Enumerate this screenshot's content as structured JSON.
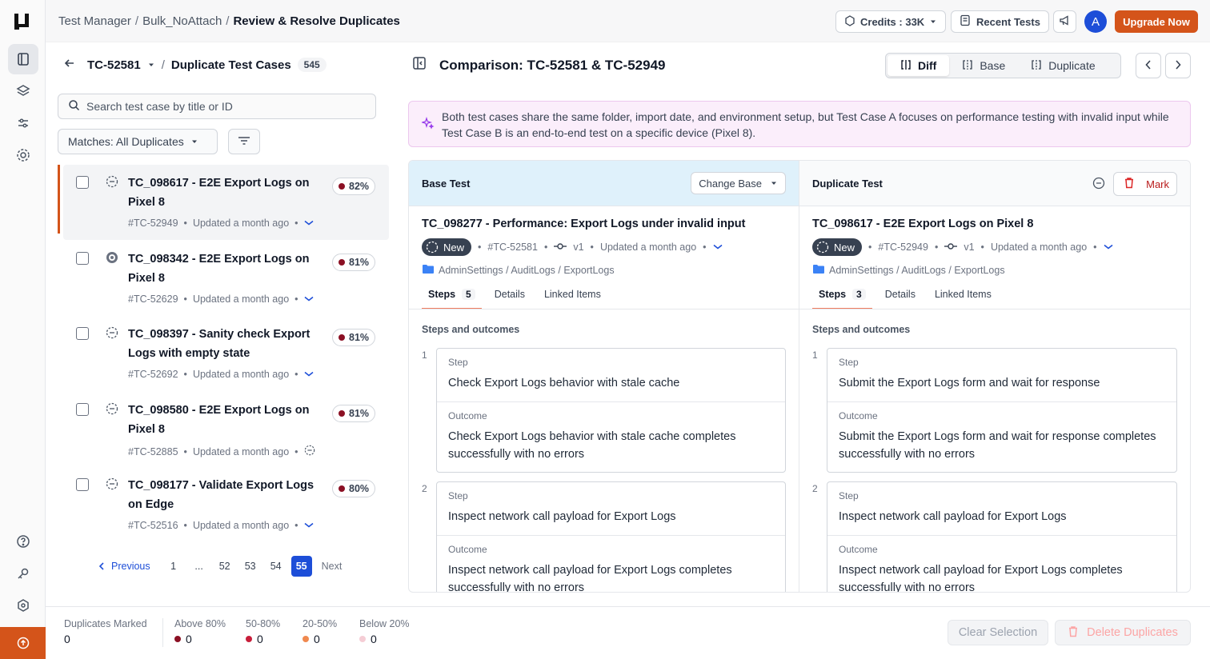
{
  "breadcrumb": {
    "items": [
      "Test Manager",
      "Bulk_NoAttach"
    ],
    "current": "Review & Resolve Duplicates"
  },
  "topbar": {
    "credits": "Credits : 33K",
    "recent_tests": "Recent Tests",
    "avatar_initial": "A",
    "upgrade": "Upgrade Now"
  },
  "left_panel": {
    "tc_id": "TC-52581",
    "title": "Duplicate Test Cases",
    "count": "545",
    "search_placeholder": "Search test case by title or ID",
    "match_filter": "Matches: All Duplicates",
    "cases": [
      {
        "title": "TC_098617 - E2E Export Logs on Pixel 8",
        "pct": "82%",
        "id": "#TC-52949",
        "updated": "Updated a month ago"
      },
      {
        "title": "TC_098342 - E2E Export Logs on Pixel 8",
        "pct": "81%",
        "id": "#TC-52629",
        "updated": "Updated a month ago"
      },
      {
        "title": "TC_098397 - Sanity check Export Logs with empty state",
        "pct": "81%",
        "id": "#TC-52692",
        "updated": "Updated a month ago"
      },
      {
        "title": "TC_098580 - E2E Export Logs on Pixel 8",
        "pct": "81%",
        "id": "#TC-52885",
        "updated": "Updated a month ago"
      },
      {
        "title": "TC_098177 - Validate Export Logs on Edge",
        "pct": "80%",
        "id": "#TC-52516",
        "updated": "Updated a month ago"
      }
    ],
    "pager": {
      "prev": "Previous",
      "next": "Next",
      "pages": [
        "1",
        "...",
        "52",
        "53",
        "54",
        "55"
      ],
      "current": "55"
    }
  },
  "comparison": {
    "title": "Comparison: TC-52581 & TC-52949",
    "views": [
      "Diff",
      "Base",
      "Duplicate"
    ],
    "active_view": "Diff",
    "summary": "Both test cases share the same folder, import date, and environment setup, but Test Case A focuses on performance testing with invalid input while Test Case B is an end-to-end test on a specific device (Pixel 8).",
    "base": {
      "header": "Base Test",
      "change_base": "Change Base",
      "title": "TC_098277 - Performance: Export Logs under invalid input",
      "status": "New",
      "id": "#TC-52581",
      "version": "v1",
      "updated": "Updated a month ago",
      "folder": "AdminSettings / AuditLogs / ExportLogs",
      "tabs": {
        "steps": "Steps",
        "steps_count": "5",
        "details": "Details",
        "linked": "Linked Items"
      },
      "section": "Steps and outcomes",
      "steps": [
        {
          "num": "1",
          "step_label": "Step",
          "step": "Check Export Logs behavior with stale cache",
          "outcome_label": "Outcome",
          "outcome": "Check Export Logs behavior with stale cache completes successfully with no errors"
        },
        {
          "num": "2",
          "step_label": "Step",
          "step": "Inspect network call payload for Export Logs",
          "outcome_label": "Outcome",
          "outcome": "Inspect network call payload for Export Logs completes successfully with no errors"
        }
      ]
    },
    "dup": {
      "header": "Duplicate Test",
      "mark": "Mark",
      "title": "TC_098617 - E2E Export Logs on Pixel 8",
      "status": "New",
      "id": "#TC-52949",
      "version": "v1",
      "updated": "Updated a month ago",
      "folder": "AdminSettings / AuditLogs / ExportLogs",
      "tabs": {
        "steps": "Steps",
        "steps_count": "3",
        "details": "Details",
        "linked": "Linked Items"
      },
      "section": "Steps and outcomes",
      "steps": [
        {
          "num": "1",
          "step_label": "Step",
          "step": "Submit the Export Logs form and wait for response",
          "outcome_label": "Outcome",
          "outcome": "Submit the Export Logs form and wait for response completes successfully with no errors"
        },
        {
          "num": "2",
          "step_label": "Step",
          "step": "Inspect network call payload for Export Logs",
          "outcome_label": "Outcome",
          "outcome": "Inspect network call payload for Export Logs completes successfully with no errors"
        }
      ]
    }
  },
  "footer": {
    "stats": [
      {
        "label": "Duplicates Marked",
        "value": "0"
      },
      {
        "label": "Above 80%",
        "value": "0",
        "color": "#8b1024"
      },
      {
        "label": "50-80%",
        "value": "0",
        "color": "#c81e3a"
      },
      {
        "label": "20-50%",
        "value": "0",
        "color": "#f0894f"
      },
      {
        "label": "Below 20%",
        "value": "0",
        "color": "#f5cdd5"
      }
    ],
    "clear": "Clear Selection",
    "delete": "Delete Duplicates"
  },
  "colors": {
    "brand": "#d4541a",
    "accent_blue": "#1d4ed8",
    "match_dot": "#8b1024"
  }
}
